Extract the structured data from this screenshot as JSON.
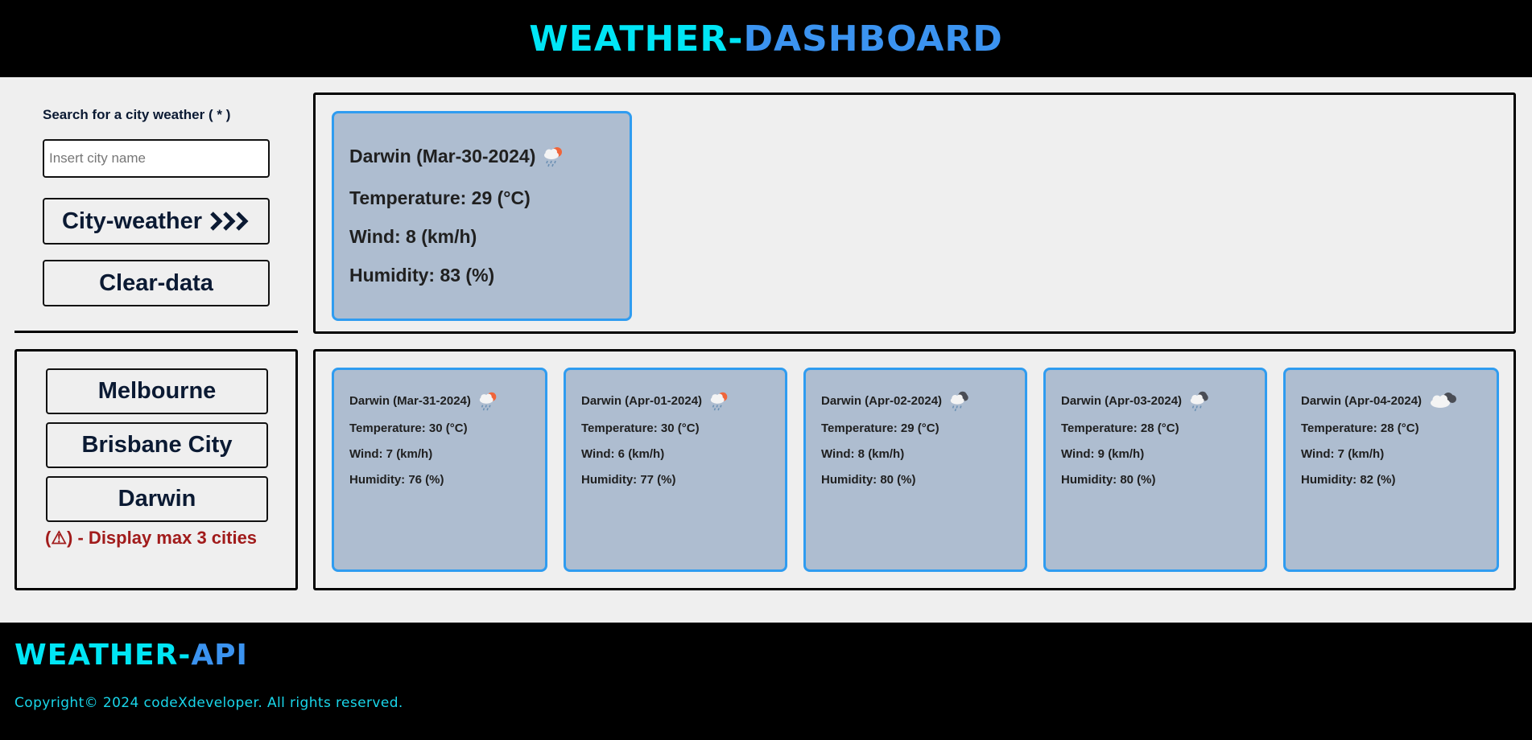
{
  "header": {
    "title_part1": "WEATHER-",
    "title_part2": "DASHBOARD"
  },
  "search": {
    "label": "Search for a city weather ( * )",
    "placeholder": "Insert city name",
    "value": "",
    "search_button_label": "City-weather",
    "clear_button_label": "Clear-data"
  },
  "history": {
    "cities": [
      "Melbourne",
      "Brisbane City",
      "Darwin"
    ],
    "warning": "(⚠) - Display max 3 cities"
  },
  "today": {
    "title": "Darwin (Mar-30-2024)",
    "icon": "light-rain-sun-icon",
    "temperature": "Temperature: 29 (°C)",
    "wind": "Wind: 8 (km/h)",
    "humidity": "Humidity: 83 (%)"
  },
  "forecast": [
    {
      "title": "Darwin (Mar-31-2024)",
      "icon": "light-rain-sun-icon",
      "temperature": "Temperature: 30 (°C)",
      "wind": "Wind: 7 (km/h)",
      "humidity": "Humidity: 76 (%)"
    },
    {
      "title": "Darwin (Apr-01-2024)",
      "icon": "light-rain-sun-icon",
      "temperature": "Temperature: 30 (°C)",
      "wind": "Wind: 6 (km/h)",
      "humidity": "Humidity: 77 (%)"
    },
    {
      "title": "Darwin (Apr-02-2024)",
      "icon": "rain-dark-cloud-icon",
      "temperature": "Temperature: 29 (°C)",
      "wind": "Wind: 8 (km/h)",
      "humidity": "Humidity: 80 (%)"
    },
    {
      "title": "Darwin (Apr-03-2024)",
      "icon": "rain-dark-cloud-icon",
      "temperature": "Temperature: 28 (°C)",
      "wind": "Wind: 9 (km/h)",
      "humidity": "Humidity: 80 (%)"
    },
    {
      "title": "Darwin (Apr-04-2024)",
      "icon": "broken-clouds-icon",
      "temperature": "Temperature: 28 (°C)",
      "wind": "Wind: 7 (km/h)",
      "humidity": "Humidity: 82 (%)"
    }
  ],
  "footer": {
    "title_part1": "WEATHER-",
    "title_part2": "API",
    "copyright": "Copyright© 2024 codeXdeveloper. All rights reserved."
  },
  "colors": {
    "brand_cyan": "#00e5f5",
    "brand_blue": "#3b93f0",
    "card_bg": "#aebdd0",
    "card_border": "#2f9cf0",
    "warning_red": "#a11b1b"
  }
}
